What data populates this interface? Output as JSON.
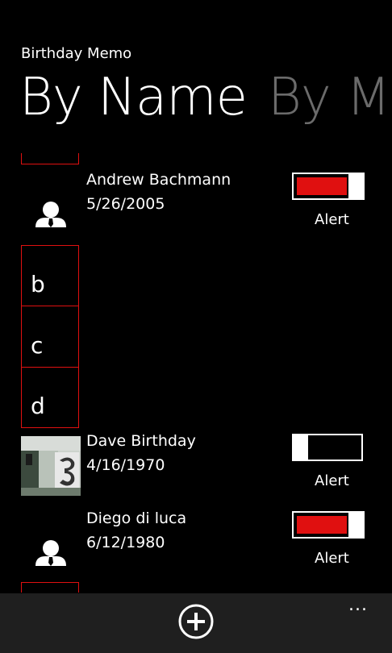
{
  "app": {
    "title": "Birthday Memo",
    "pivots": [
      {
        "label": "By Name",
        "active": true
      },
      {
        "label": "By M",
        "active": false
      }
    ]
  },
  "list": {
    "contacts": [
      {
        "name": "Andrew Bachmann",
        "date": "5/26/2005",
        "alert_on": true,
        "toggle_label": "Alert",
        "avatar": "person-icon"
      },
      {
        "name": "Dave Birthday",
        "date": "4/16/1970",
        "alert_on": false,
        "toggle_label": "Alert",
        "avatar": "photo"
      },
      {
        "name": "Diego di luca",
        "date": "6/12/1980",
        "alert_on": true,
        "toggle_label": "Alert",
        "avatar": "person-icon"
      }
    ],
    "letters": [
      "b",
      "c",
      "d"
    ]
  },
  "appbar": {
    "add_icon": "add-circle-icon",
    "more_label": "..."
  },
  "colors": {
    "accent": "#e01010",
    "background": "#000000",
    "appbar": "#1f1f1f",
    "inactive_pivot": "#6b6b6b"
  }
}
